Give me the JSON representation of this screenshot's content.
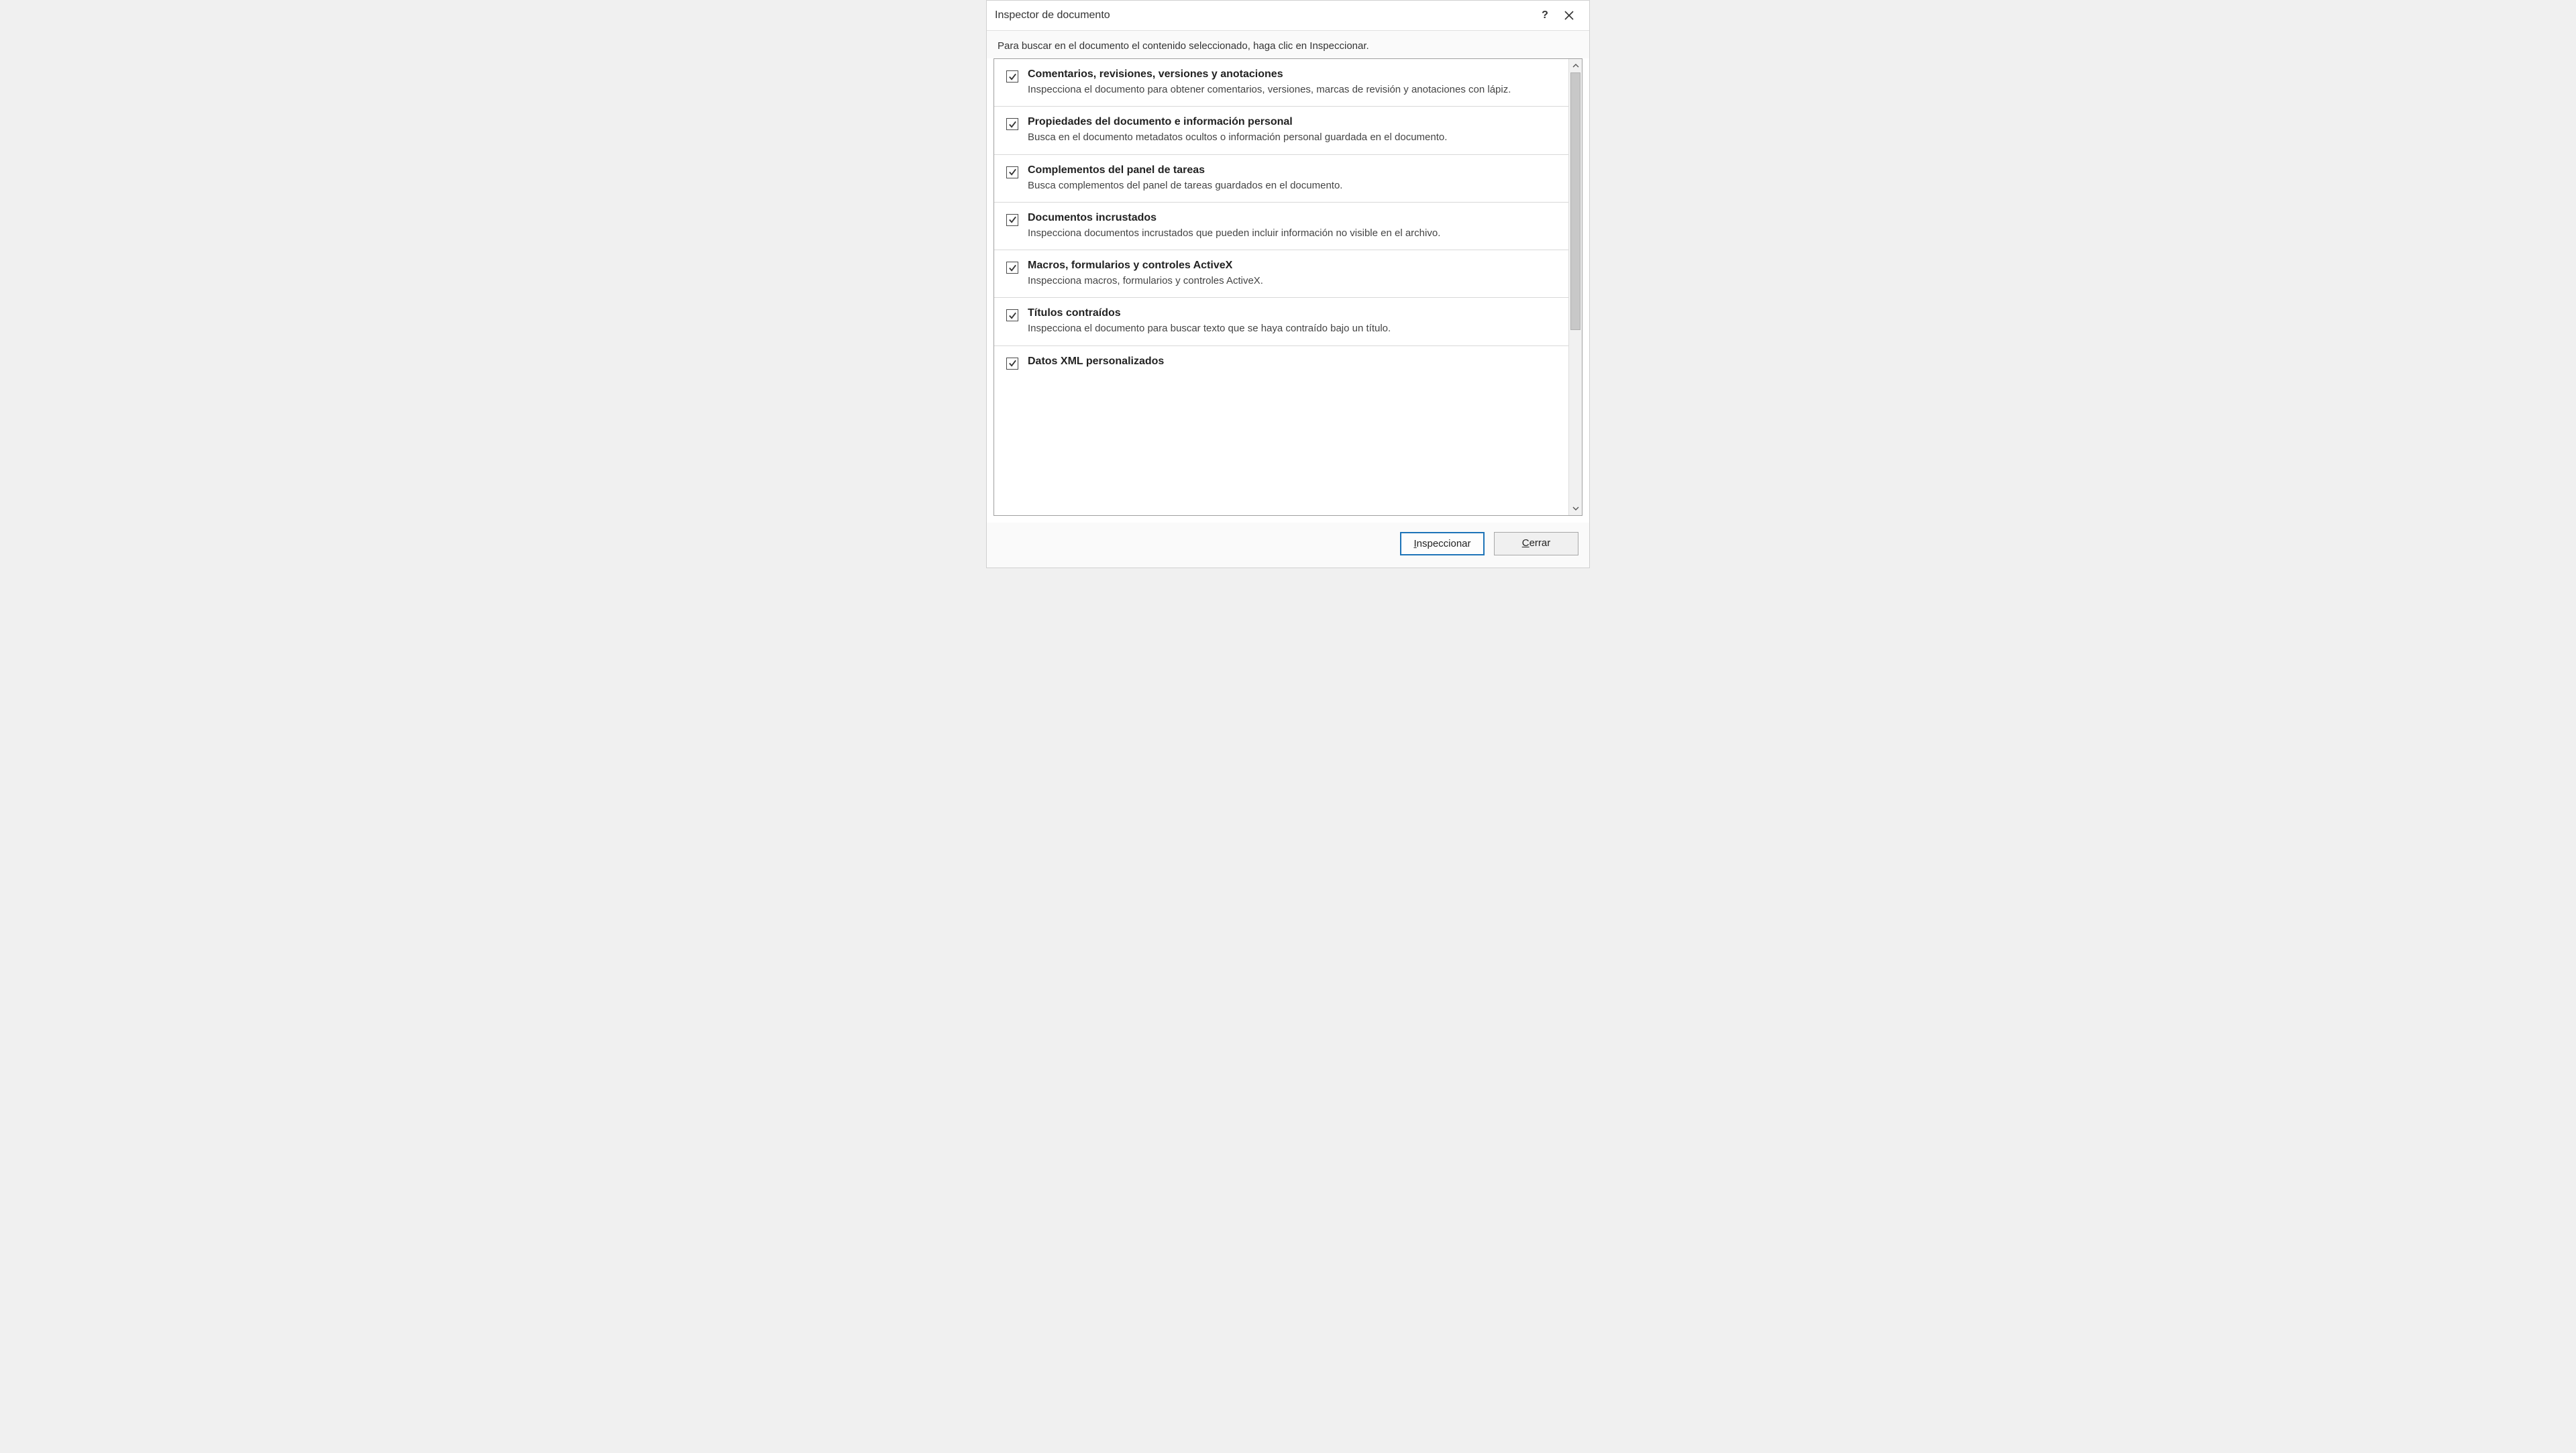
{
  "titlebar": {
    "title": "Inspector de documento",
    "help": "?",
    "close": "×"
  },
  "instruction": "Para buscar en el documento el contenido seleccionado, haga clic en Inspeccionar.",
  "items": [
    {
      "checked": true,
      "title": "Comentarios, revisiones, versiones y anotaciones",
      "desc": "Inspecciona el documento para obtener comentarios, versiones, marcas de revisión y anotaciones con lápiz."
    },
    {
      "checked": true,
      "title": "Propiedades del documento e información personal",
      "desc": "Busca en el documento metadatos ocultos o información personal guardada en el documento."
    },
    {
      "checked": true,
      "title": "Complementos del panel de tareas",
      "desc": "Busca complementos del panel de tareas guardados en el documento."
    },
    {
      "checked": true,
      "title": "Documentos incrustados",
      "desc": "Inspecciona documentos incrustados que pueden incluir información no visible en el archivo."
    },
    {
      "checked": true,
      "title": "Macros, formularios y controles ActiveX",
      "desc": "Inspecciona macros, formularios y controles ActiveX."
    },
    {
      "checked": true,
      "title": "Títulos contraídos",
      "desc": "Inspecciona el documento para buscar texto que se haya contraído bajo un título."
    },
    {
      "checked": true,
      "title": "Datos XML personalizados",
      "desc": ""
    }
  ],
  "footer": {
    "inspect": "Inspeccionar",
    "close": "Cerrar"
  }
}
